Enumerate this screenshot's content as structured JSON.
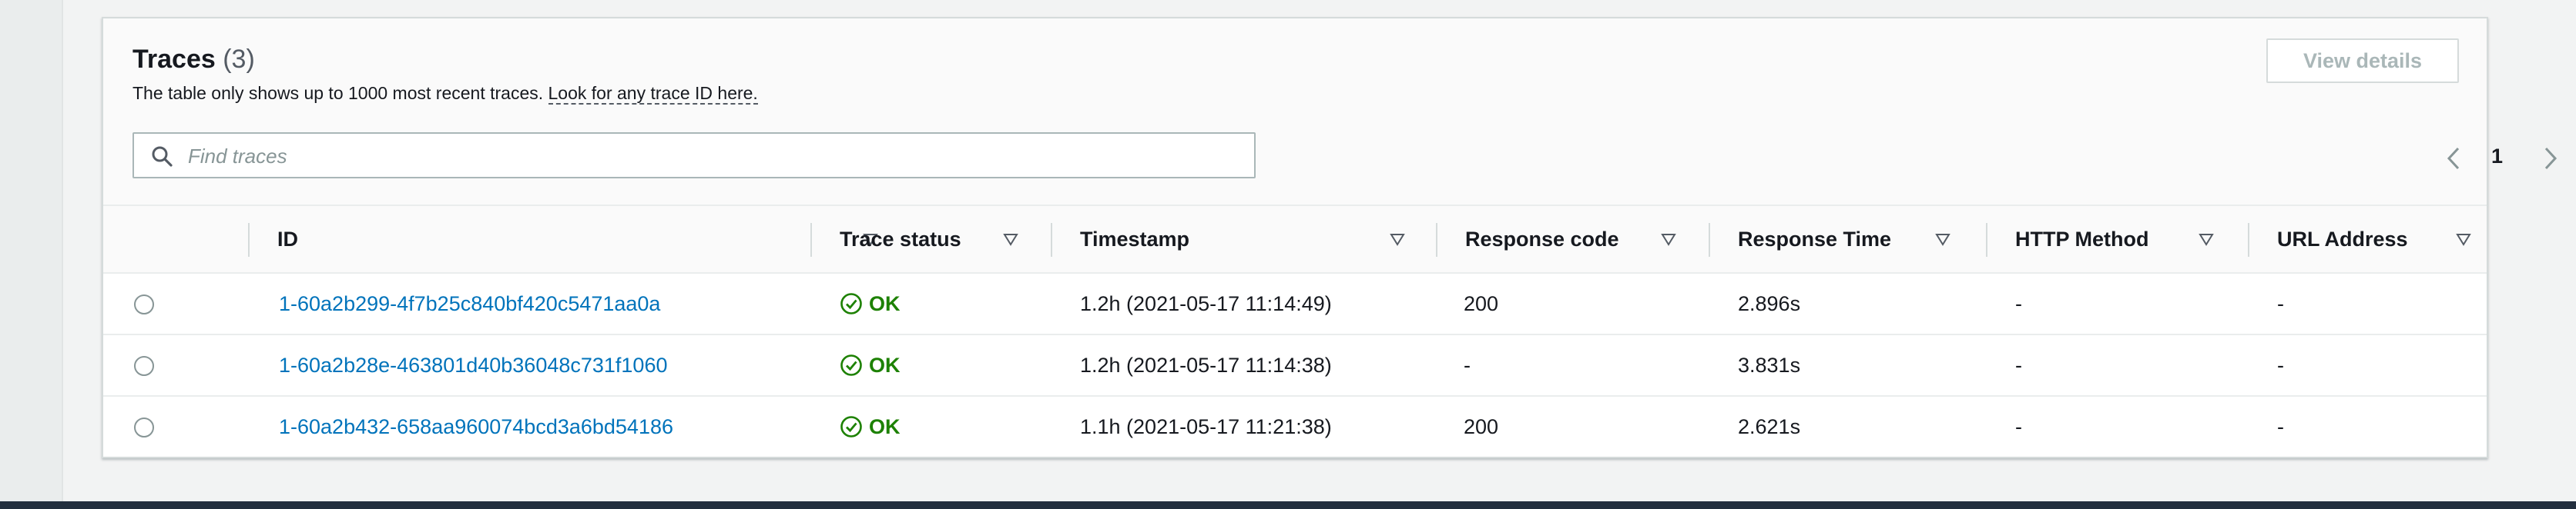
{
  "traces": {
    "title": "Traces",
    "count": "(3)",
    "subtitle": "The table only shows up to 1000 most recent traces.",
    "lookup_link": "Look for any trace ID here.",
    "view_details_label": "View details",
    "search_placeholder": "Find traces",
    "current_page": "1",
    "columns": [
      "ID",
      "Trace status",
      "Timestamp",
      "Response code",
      "Response Time",
      "HTTP Method",
      "URL Address"
    ],
    "rows": [
      {
        "id": "1-60a2b299-4f7b25c840bf420c5471aa0a",
        "status": "OK",
        "timestamp": "1.2h (2021-05-17 11:14:49)",
        "response_code": "200",
        "response_time": "2.896s",
        "http_method": "-",
        "url": "-"
      },
      {
        "id": "1-60a2b28e-463801d40b36048c731f1060",
        "status": "OK",
        "timestamp": "1.2h (2021-05-17 11:14:38)",
        "response_code": "-",
        "response_time": "3.831s",
        "http_method": "-",
        "url": "-"
      },
      {
        "id": "1-60a2b432-658aa960074bcd3a6bd54186",
        "status": "OK",
        "timestamp": "1.1h (2021-05-17 11:21:38)",
        "response_code": "200",
        "response_time": "2.621s",
        "http_method": "-",
        "url": "-"
      }
    ]
  },
  "colors": {
    "link": "#0073bb",
    "status_ok": "#1d8102",
    "bottom_bar": "#232f3e"
  },
  "icons": {
    "search": "search-icon",
    "sort": "caret-down-outline-icon",
    "status_ok": "check-circle-icon",
    "prev": "chevron-left-icon",
    "next": "chevron-right-icon"
  }
}
